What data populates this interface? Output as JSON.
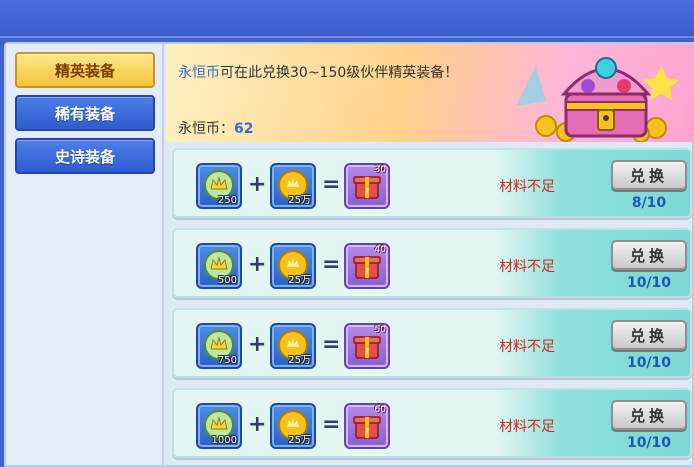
{
  "sidebar": {
    "items": [
      {
        "label": "精英装备",
        "active": true
      },
      {
        "label": "稀有装备",
        "active": false
      },
      {
        "label": "史诗装备",
        "active": false
      }
    ]
  },
  "banner": {
    "currency_name": "永恒币",
    "description": "可在此兑换30~150级伙伴精英装备！",
    "balance_label": "永恒币：",
    "balance_value": "62"
  },
  "rows": [
    {
      "coin_qty": "250",
      "gold_qty": "25万",
      "gift_level": "30",
      "status": "材料不足",
      "button": "兑换",
      "count": "8/10"
    },
    {
      "coin_qty": "500",
      "gold_qty": "25万",
      "gift_level": "40",
      "status": "材料不足",
      "button": "兑换",
      "count": "10/10"
    },
    {
      "coin_qty": "750",
      "gold_qty": "25万",
      "gift_level": "50",
      "status": "材料不足",
      "button": "兑换",
      "count": "10/10"
    },
    {
      "coin_qty": "1000",
      "gold_qty": "25万",
      "gift_level": "60",
      "status": "材料不足",
      "button": "兑换",
      "count": "10/10"
    }
  ],
  "operators": {
    "plus": "+",
    "equals": "="
  },
  "icons": {
    "coin": "eternal-coin-icon",
    "gold": "gold-coin-icon",
    "gift": "gift-box-icon",
    "chest": "treasure-chest-icon"
  },
  "colors": {
    "accent_blue": "#2f6fd0",
    "status_red": "#d42424",
    "active_tab": "#f3c43a"
  }
}
